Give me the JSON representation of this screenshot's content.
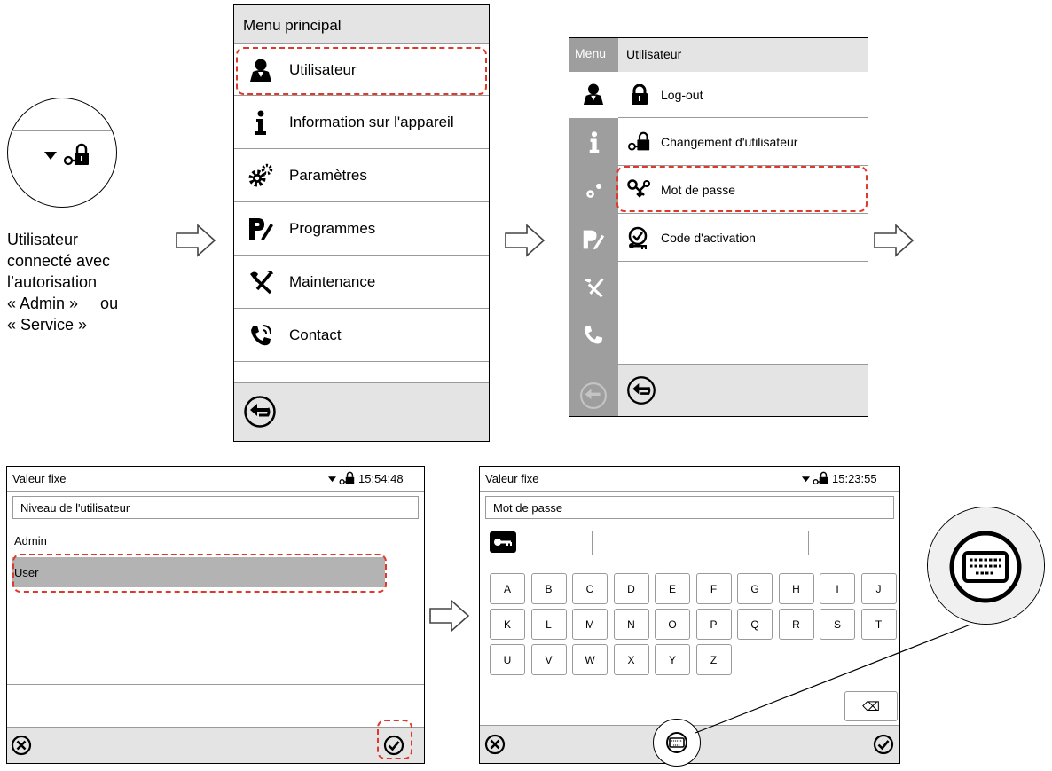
{
  "annotation": {
    "text_lines": [
      "Utilisateur",
      "connecté avec",
      "l’autorisation",
      "« Admin »     ou",
      "« Service »"
    ]
  },
  "main_menu": {
    "title": "Menu principal",
    "items": [
      {
        "label": "Utilisateur",
        "icon": "user-icon"
      },
      {
        "label": "Information sur l'appareil",
        "icon": "info-icon"
      },
      {
        "label": "Paramètres",
        "icon": "gears-icon"
      },
      {
        "label": "Programmes",
        "icon": "program-pen-icon"
      },
      {
        "label": "Maintenance",
        "icon": "tools-icon"
      },
      {
        "label": "Contact",
        "icon": "phone-icon"
      }
    ]
  },
  "user_menu": {
    "side_label": "Menu",
    "title": "Utilisateur",
    "items": [
      {
        "label": "Log-out",
        "icon": "lock-icon"
      },
      {
        "label": "Changement d'utilisateur",
        "icon": "key-lock-icon"
      },
      {
        "label": "Mot de passe",
        "icon": "keys-icon"
      },
      {
        "label": "Code d'activation",
        "icon": "activation-code-icon"
      }
    ]
  },
  "user_level": {
    "header_title": "Valeur fixe",
    "time": "15:54:48",
    "section_title": "Niveau de l'utilisateur",
    "options": [
      "Admin",
      "User"
    ],
    "selected": "User"
  },
  "password": {
    "header_title": "Valeur fixe",
    "time": "15:23:55",
    "section_title": "Mot de passe",
    "field_value": "",
    "keyboard_rows": [
      [
        "A",
        "B",
        "C",
        "D",
        "E",
        "F",
        "G",
        "H",
        "I",
        "J"
      ],
      [
        "K",
        "L",
        "M",
        "N",
        "O",
        "P",
        "Q",
        "R",
        "S",
        "T"
      ],
      [
        "U",
        "V",
        "W",
        "X",
        "Y",
        "Z"
      ]
    ],
    "backspace_symbol": "⌫"
  },
  "colors": {
    "highlight": "#e0392b",
    "header_grey": "#e4e4e4",
    "side_grey": "#9e9e9e",
    "selected_row": "#b3b3b3"
  }
}
